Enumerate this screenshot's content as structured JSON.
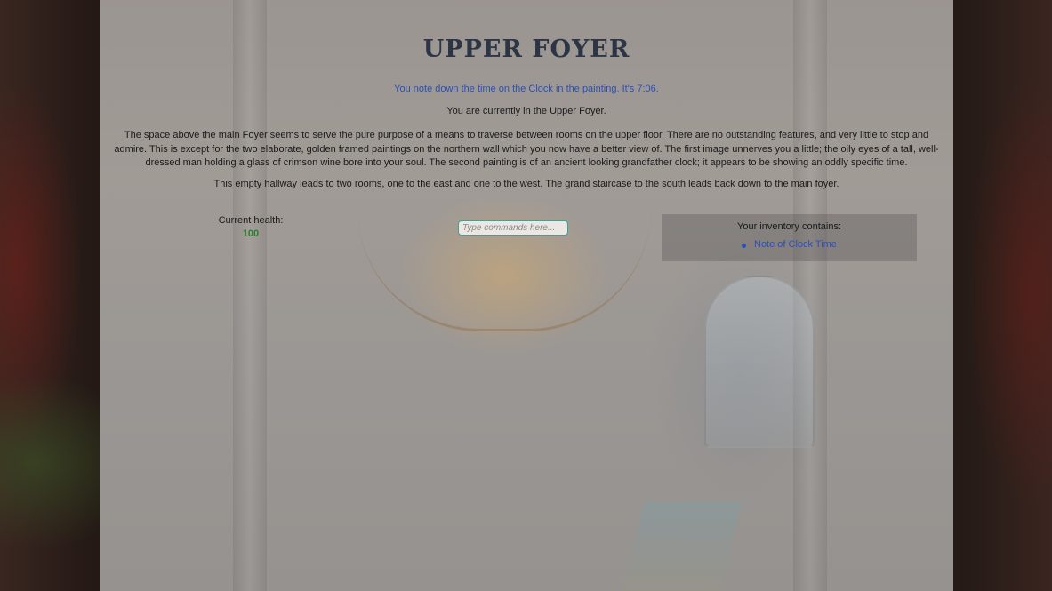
{
  "room": {
    "title": "UPPER FOYER",
    "notice": "You note down the time on the Clock in the painting. It's 7:06.",
    "location": "You are currently in the Upper Foyer.",
    "description": "The space above the main Foyer seems to serve the pure purpose of a means to traverse between rooms on the upper floor. There are no outstanding features, and very little to stop and admire. This is except for the two elaborate, golden framed paintings on the northern wall which you now have a better view of. The first image unnerves you a little; the oily eyes of a tall, well-dressed man holding a glass of crimson wine bore into your soul. The second painting is of an ancient looking grandfather clock; it appears to be showing an oddly specific time.",
    "exits": "This empty hallway leads to two rooms, one to the east and one to the west. The grand staircase to the south leads back down to the main foyer."
  },
  "status": {
    "health_label": "Current health:",
    "health_value": "100"
  },
  "command": {
    "placeholder": "Type commands here...",
    "value": ""
  },
  "inventory": {
    "title": "Your inventory contains:",
    "items": [
      "Note of Clock Time"
    ]
  },
  "colors": {
    "title": "#2d3545",
    "notice": "#2a4fbd",
    "health": "#2e7d32",
    "inventory_item": "#2a4fbd",
    "input_border": "#3aa39b"
  }
}
